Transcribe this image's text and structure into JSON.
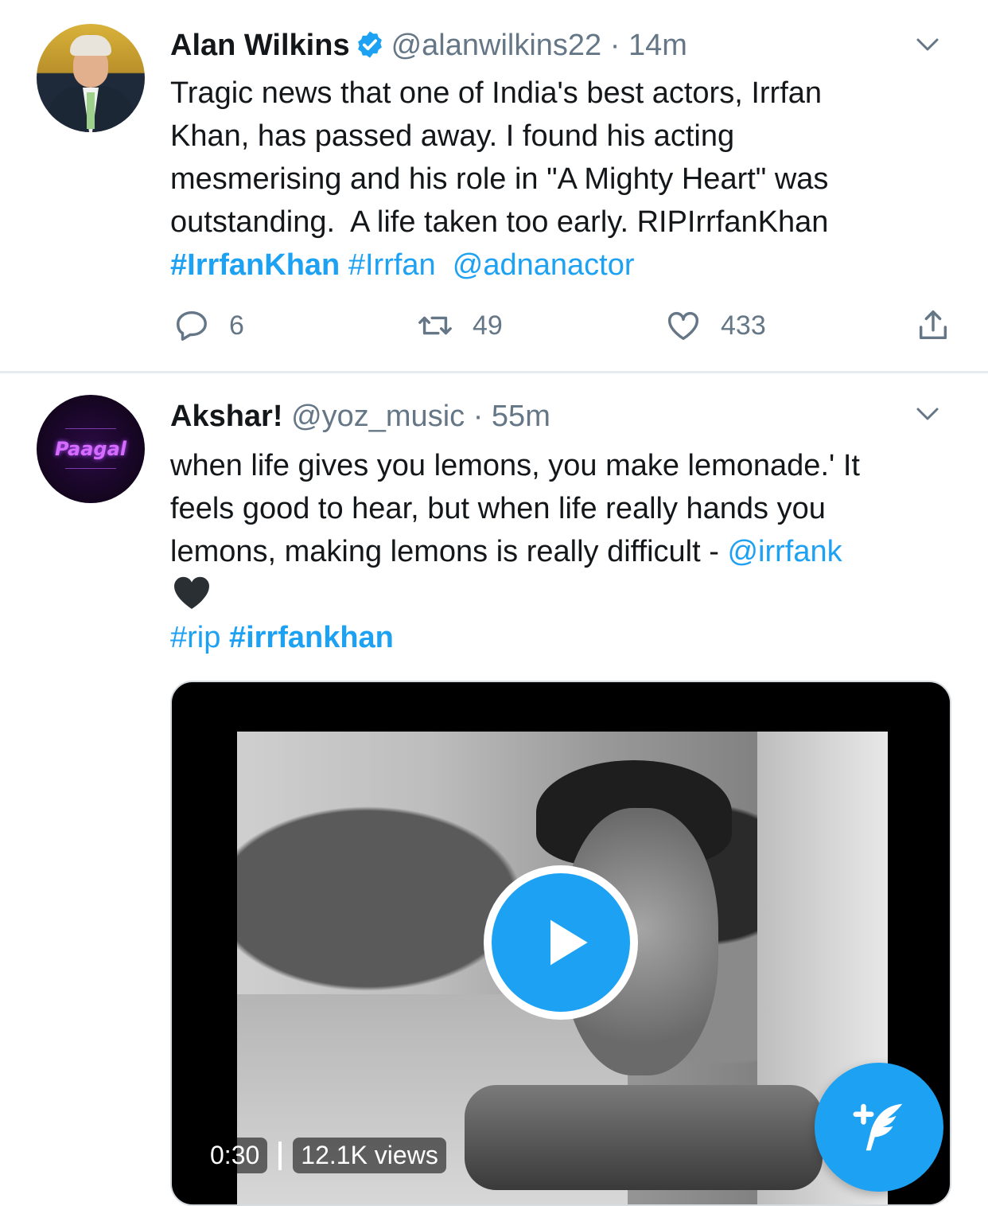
{
  "tweets": [
    {
      "name": "Alan Wilkins",
      "handle": "@alanwilkins22",
      "separator": "·",
      "time": "14m",
      "text_line1": "Tragic news that one of India's best actors, Irrfan",
      "text_line2": "Khan, has passed away. I found his acting",
      "text_line3": "mesmerising and his role in \"A Mighty Heart\" was",
      "text_line4": "outstanding.  A life taken too early. RIPIrrfanKhan",
      "hashtag1": "#IrrfanKhan",
      "hashtag2": "#Irrfan",
      "mention": "@adnanactor",
      "reply_count": "6",
      "retweet_count": "49",
      "like_count": "433"
    },
    {
      "name": "Akshar!",
      "handle": "@yoz_music",
      "separator": "·",
      "time": "55m",
      "avatar_text": "Paagal",
      "text_line1": "when life gives you lemons, you make lemonade.' It",
      "text_line2": "feels good to hear, but when life really hands you",
      "text_line3": "lemons, making lemons is really difficult - ",
      "mention": "@irrfank",
      "hashtag1": "#rip",
      "hashtag2": "#irrfankhan",
      "video_duration": "0:30",
      "video_views": "12.1K views"
    }
  ],
  "colors": {
    "accent": "#1da1f2",
    "muted": "#657786",
    "text": "#14171a",
    "divider": "#e6ecf0"
  },
  "icons": [
    "verified-icon",
    "chevron-down-icon",
    "reply-icon",
    "retweet-icon",
    "like-icon",
    "share-icon",
    "black-heart-emoji",
    "play-icon",
    "compose-tweet-icon"
  ]
}
